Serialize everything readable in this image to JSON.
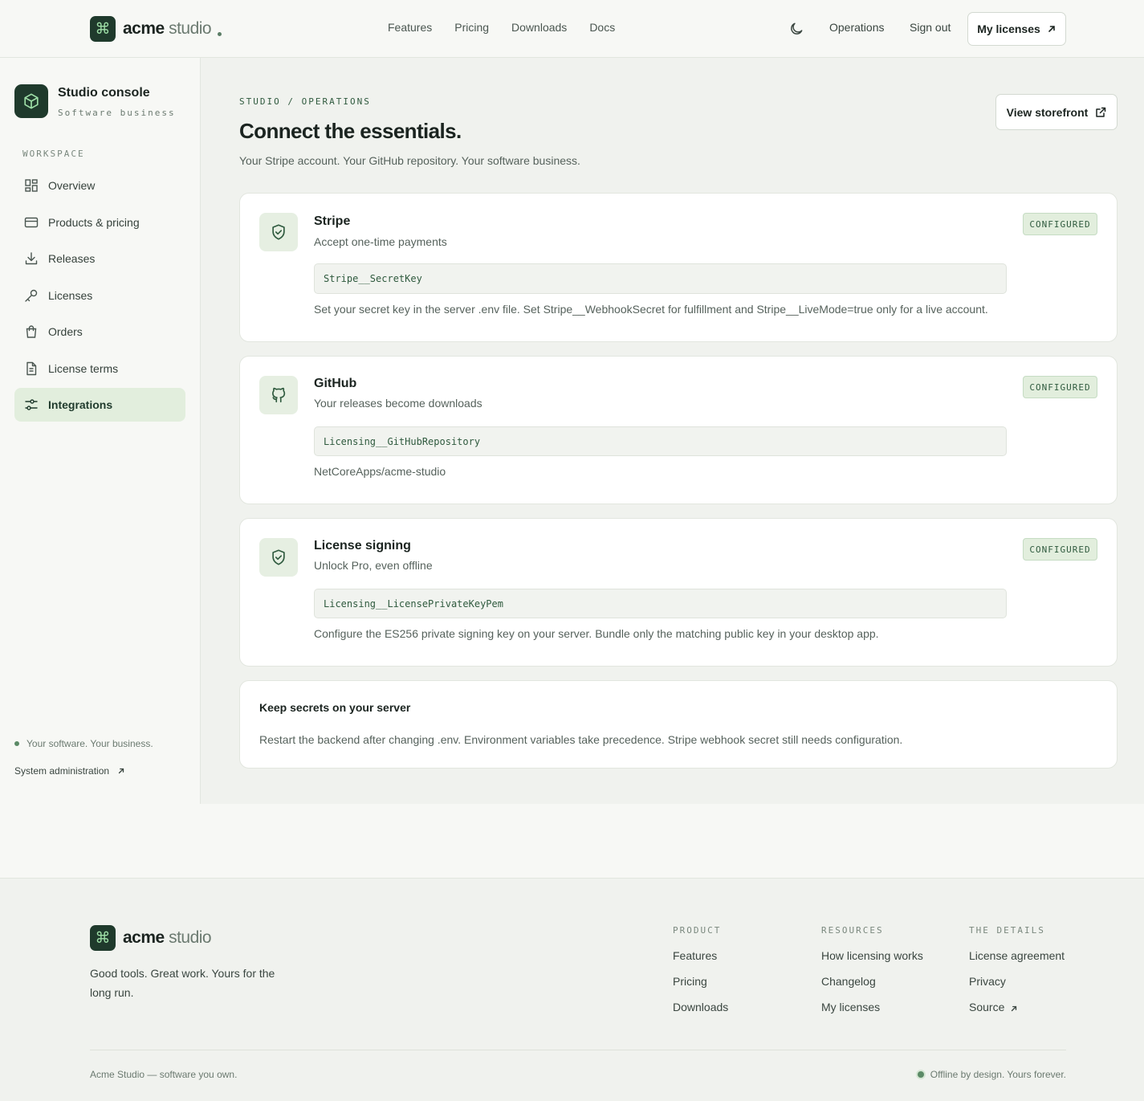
{
  "brand": {
    "name_bold": "acme",
    "name_light": "studio",
    "mark": "⌘"
  },
  "nav": {
    "links": [
      "Features",
      "Pricing",
      "Downloads",
      "Docs"
    ],
    "operations": "Operations",
    "sign_out": "Sign out",
    "my_licenses": "My licenses"
  },
  "sidebar": {
    "title": "Studio console",
    "subtitle": "Software business",
    "section_label": "WORKSPACE",
    "items": [
      {
        "label": "Overview",
        "icon": "grid-icon"
      },
      {
        "label": "Products & pricing",
        "icon": "card-icon"
      },
      {
        "label": "Releases",
        "icon": "download-icon"
      },
      {
        "label": "Licenses",
        "icon": "key-icon"
      },
      {
        "label": "Orders",
        "icon": "bag-icon"
      },
      {
        "label": "License terms",
        "icon": "document-icon"
      },
      {
        "label": "Integrations",
        "icon": "sliders-icon",
        "active": true
      }
    ],
    "footer_tagline": "Your software. Your business.",
    "footer_link": "System administration"
  },
  "main": {
    "breadcrumb": "STUDIO / OPERATIONS",
    "title": "Connect the essentials.",
    "subtitle": "Your Stripe account. Your GitHub repository. Your software business.",
    "storefront_button": "View storefront",
    "cards": [
      {
        "title": "Stripe",
        "description": "Accept one-time payments",
        "key": "Stripe__SecretKey",
        "note": "Set your secret key in the server .env file. Set Stripe__WebhookSecret for fulfillment and Stripe__LiveMode=true only for a live account.",
        "status": "CONFIGURED",
        "icon": "shield-check-icon"
      },
      {
        "title": "GitHub",
        "description": "Your releases become downloads",
        "key": "Licensing__GitHubRepository",
        "note": "NetCoreApps/acme-studio",
        "status": "CONFIGURED",
        "icon": "github-icon"
      },
      {
        "title": "License signing",
        "description": "Unlock Pro, even offline",
        "key": "Licensing__LicensePrivateKeyPem",
        "note": "Configure the ES256 private signing key on your server. Bundle only the matching public key in your desktop app.",
        "status": "CONFIGURED",
        "icon": "shield-check-icon"
      }
    ],
    "tip": {
      "title": "Keep secrets on your server",
      "text": "Restart the backend after changing .env. Environment variables take precedence. Stripe webhook secret still needs configuration."
    }
  },
  "footer": {
    "tagline": "Good tools. Great work. Yours for the long run.",
    "columns": [
      {
        "heading": "PRODUCT",
        "links": [
          "Features",
          "Pricing",
          "Downloads"
        ]
      },
      {
        "heading": "RESOURCES",
        "links": [
          "How licensing works",
          "Changelog",
          "My licenses"
        ]
      },
      {
        "heading": "THE DETAILS",
        "links": [
          "License agreement",
          "Privacy",
          "Source"
        ]
      }
    ],
    "copyright": "Acme Studio — software you own.",
    "status": "Offline by design. Yours forever."
  },
  "colors": {
    "brand_dark": "#1f3a2c",
    "accent_green": "#2f5a3e",
    "badge_bg": "#e2eedd"
  }
}
